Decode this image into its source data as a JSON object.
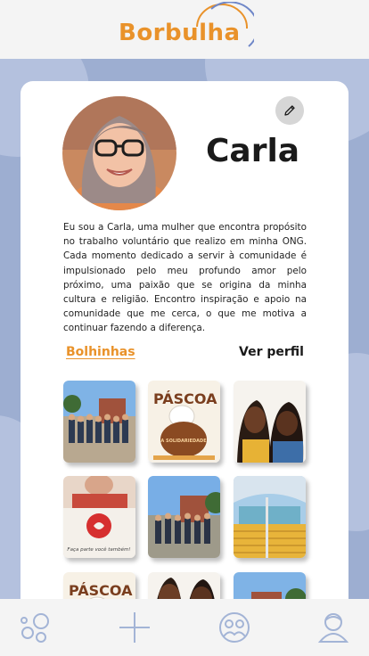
{
  "app": {
    "logo_text": "Borbulha"
  },
  "colors": {
    "accent": "#e9922a",
    "background": "#9daed1",
    "card": "#ffffff",
    "nav_icon": "#a3b4d6"
  },
  "profile": {
    "name": "Carla",
    "bio": "Eu sou a Carla, uma mulher que encontra propósito no trabalho voluntário que realizo em minha ONG. Cada momento dedicado a servir à comunidade é impulsionado pelo meu profundo amor pelo próximo, uma paixão que se origina da minha cultura e religião. Encontro inspiração e apoio na comunidade que me cerca, o que me motiva a continuar fazendo a diferença."
  },
  "tabs": {
    "bolhinhas": "Bolhinhas",
    "ver_perfil": "Ver perfil"
  },
  "posts": [
    {
      "kind": "group-photo"
    },
    {
      "kind": "easter-poster",
      "text": "PÁSCOA",
      "subtext": "A SOLIDARIEDADE"
    },
    {
      "kind": "illustration"
    },
    {
      "kind": "sign-photo",
      "text": "Faça parte você também!"
    },
    {
      "kind": "group-photo"
    },
    {
      "kind": "building-photo"
    },
    {
      "kind": "easter-poster",
      "text": "PÁSCOA"
    },
    {
      "kind": "illustration"
    },
    {
      "kind": "landscape-photo"
    }
  ],
  "nav": {
    "items": [
      {
        "icon": "bubbles-icon"
      },
      {
        "icon": "plus-icon"
      },
      {
        "icon": "community-icon"
      },
      {
        "icon": "profile-icon"
      }
    ]
  }
}
